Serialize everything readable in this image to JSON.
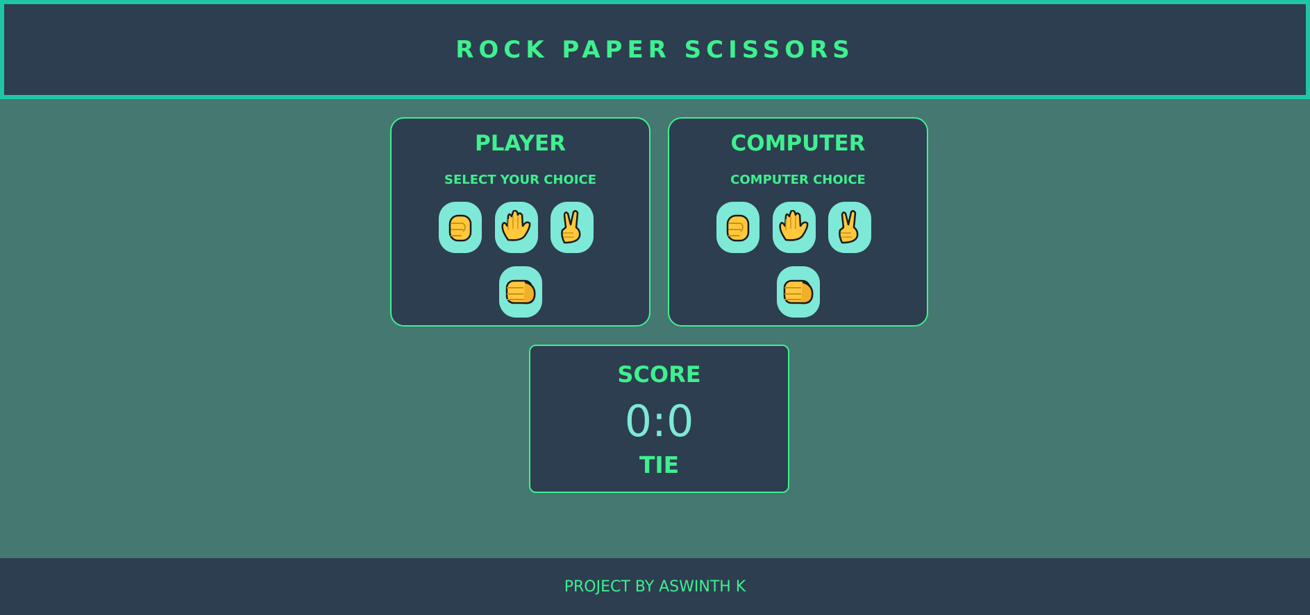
{
  "header": {
    "title": "ROCK PAPER SCISSORS"
  },
  "player": {
    "title": "PLAYER",
    "subtitle": "SELECT YOUR CHOICE",
    "choices": [
      "raised-fist-icon",
      "raised-hand-icon",
      "victory-hand-icon",
      "oncoming-fist-icon"
    ]
  },
  "computer": {
    "title": "COMPUTER",
    "subtitle": "COMPUTER CHOICE",
    "choices": [
      "raised-fist-icon",
      "raised-hand-icon",
      "victory-hand-icon",
      "oncoming-fist-icon"
    ]
  },
  "score": {
    "label": "SCORE",
    "value": "0:0",
    "result": "TIE"
  },
  "footer": {
    "credit": "PROJECT BY ASWINTH K"
  },
  "colors": {
    "background": "#457870",
    "panel": "#2c3e50",
    "accent": "#3ff08f",
    "header_border": "#1fc6a6",
    "choice_bg": "#7ee9d6",
    "emoji_yellow": "#ffc83d"
  }
}
